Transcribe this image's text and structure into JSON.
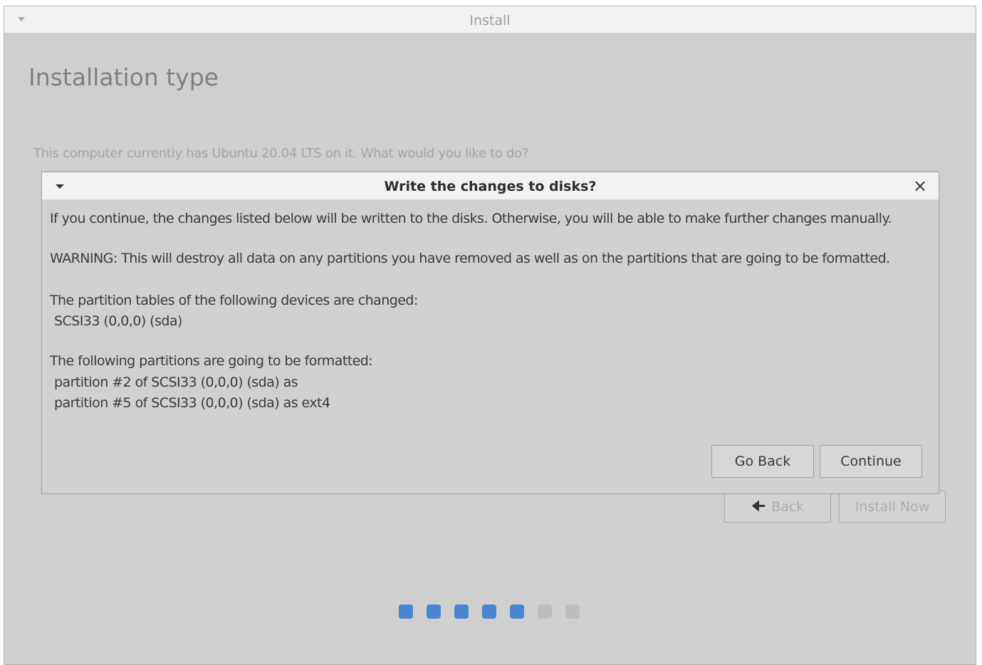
{
  "window": {
    "title": "Install",
    "heading": "Installation type",
    "question": "This computer currently has Ubuntu 20.04 LTS on it. What would you like to do?",
    "back_label": "Back",
    "install_now_label": "Install Now"
  },
  "progress": {
    "total_steps": 7,
    "completed_steps": 5,
    "active_color": "#4a86cf",
    "inactive_color": "#bdbdbd"
  },
  "dialog": {
    "title": "Write the changes to disks?",
    "close_glyph": "×",
    "line1": "If you continue, the changes listed below will be written to the disks. Otherwise, you will be able to make further changes manually.",
    "line2": "WARNING: This will destroy all data on any partitions you have removed as well as on the partitions that are going to be formatted.",
    "tables_header": "The partition tables of the following devices are changed:",
    "tables_item": "SCSI33 (0,0,0) (sda)",
    "formatted_header": "The following partitions are going to be formatted:",
    "formatted_items": [
      "partition #2 of SCSI33 (0,0,0) (sda) as",
      "partition #5 of SCSI33 (0,0,0) (sda) as ext4"
    ],
    "go_back_label": "Go Back",
    "continue_label": "Continue"
  }
}
